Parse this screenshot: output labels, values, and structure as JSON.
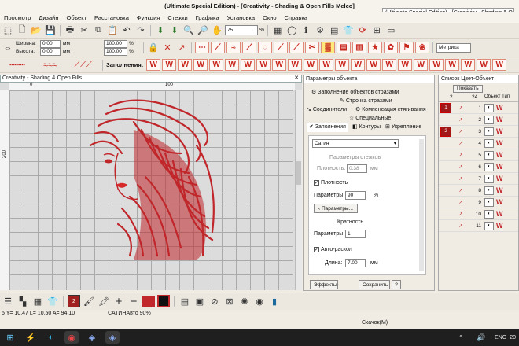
{
  "title": "(Ultimate Special Edition) - [Creativity - Shading & Open Fills     Melco]",
  "ext_title": "(Ultimate Special Edition) - [Creativity - Shading & Open",
  "menu": [
    "Просмотр",
    "Дизайн",
    "Объект",
    "Расстановка",
    "Функция",
    "Стежки",
    "Графика",
    "Установка",
    "Окно",
    "Справка"
  ],
  "toolbar2": {
    "zoom_value": "75",
    "zoom_unit": "%"
  },
  "toolbar3": {
    "width_label": "Ширина:",
    "width_value": "0.00",
    "width_pct": "100.00",
    "height_label": "Высота:",
    "height_value": "0.00",
    "height_pct": "100.00",
    "unit_pct": "%",
    "unit_mm": "мм",
    "metric": "Метрика"
  },
  "fills_label": "Заполнения:",
  "document": {
    "title": "Creativity - Shading & Open Fills",
    "ruler_0": "0",
    "ruler_100": "100",
    "ruler_v_200": "200"
  },
  "object_panel": {
    "title": "Параметры объекта",
    "tab_rhinestone": "Заполнение объектов стразами",
    "tab_line_strass": "Строчка стразами",
    "tab_connections": "Соединители",
    "tab_pull_comp": "Компенсация стягивания",
    "tab_special": "Специальные",
    "tab_fills": "Заполнения",
    "tab_outlines": "Контуры",
    "tab_underlay": "Укрепление",
    "fill_type": "Сатин",
    "stitch_params": "Параметры стежков",
    "density_label": "Плотность:",
    "density_value": "0.38",
    "density_unit": "мм",
    "density_check": "Плотность",
    "params_label": "Параметры:",
    "params_value": "90",
    "params_unit": "%",
    "params_button": "Параметры...",
    "multiplicity": "Кратность",
    "mult_value": "1",
    "autosplit": "Авто-раскол",
    "length_label": "Длина:",
    "length_value": "7.00",
    "length_unit": "мм",
    "effects_button": "Эффекты",
    "save_button": "Сохранить",
    "help_button": "?"
  },
  "color_list": {
    "title": "Список Цвет-Объект",
    "show_button": "Показать",
    "header_col1": "2",
    "header_col2": "24",
    "side_label": "Объект Тип",
    "rows": [
      "1",
      "2",
      "3",
      "4",
      "5",
      "6",
      "7",
      "8",
      "9",
      "10",
      "11"
    ]
  },
  "status": {
    "text": "5 Y= 10.47 L= 10.50 A= 94.10",
    "mode": "САТИН",
    "auto": "Авто 90%"
  },
  "download_label": "Скачок(M)",
  "taskbar": {
    "lang": "ENG",
    "time": "20",
    "flags": "^"
  }
}
